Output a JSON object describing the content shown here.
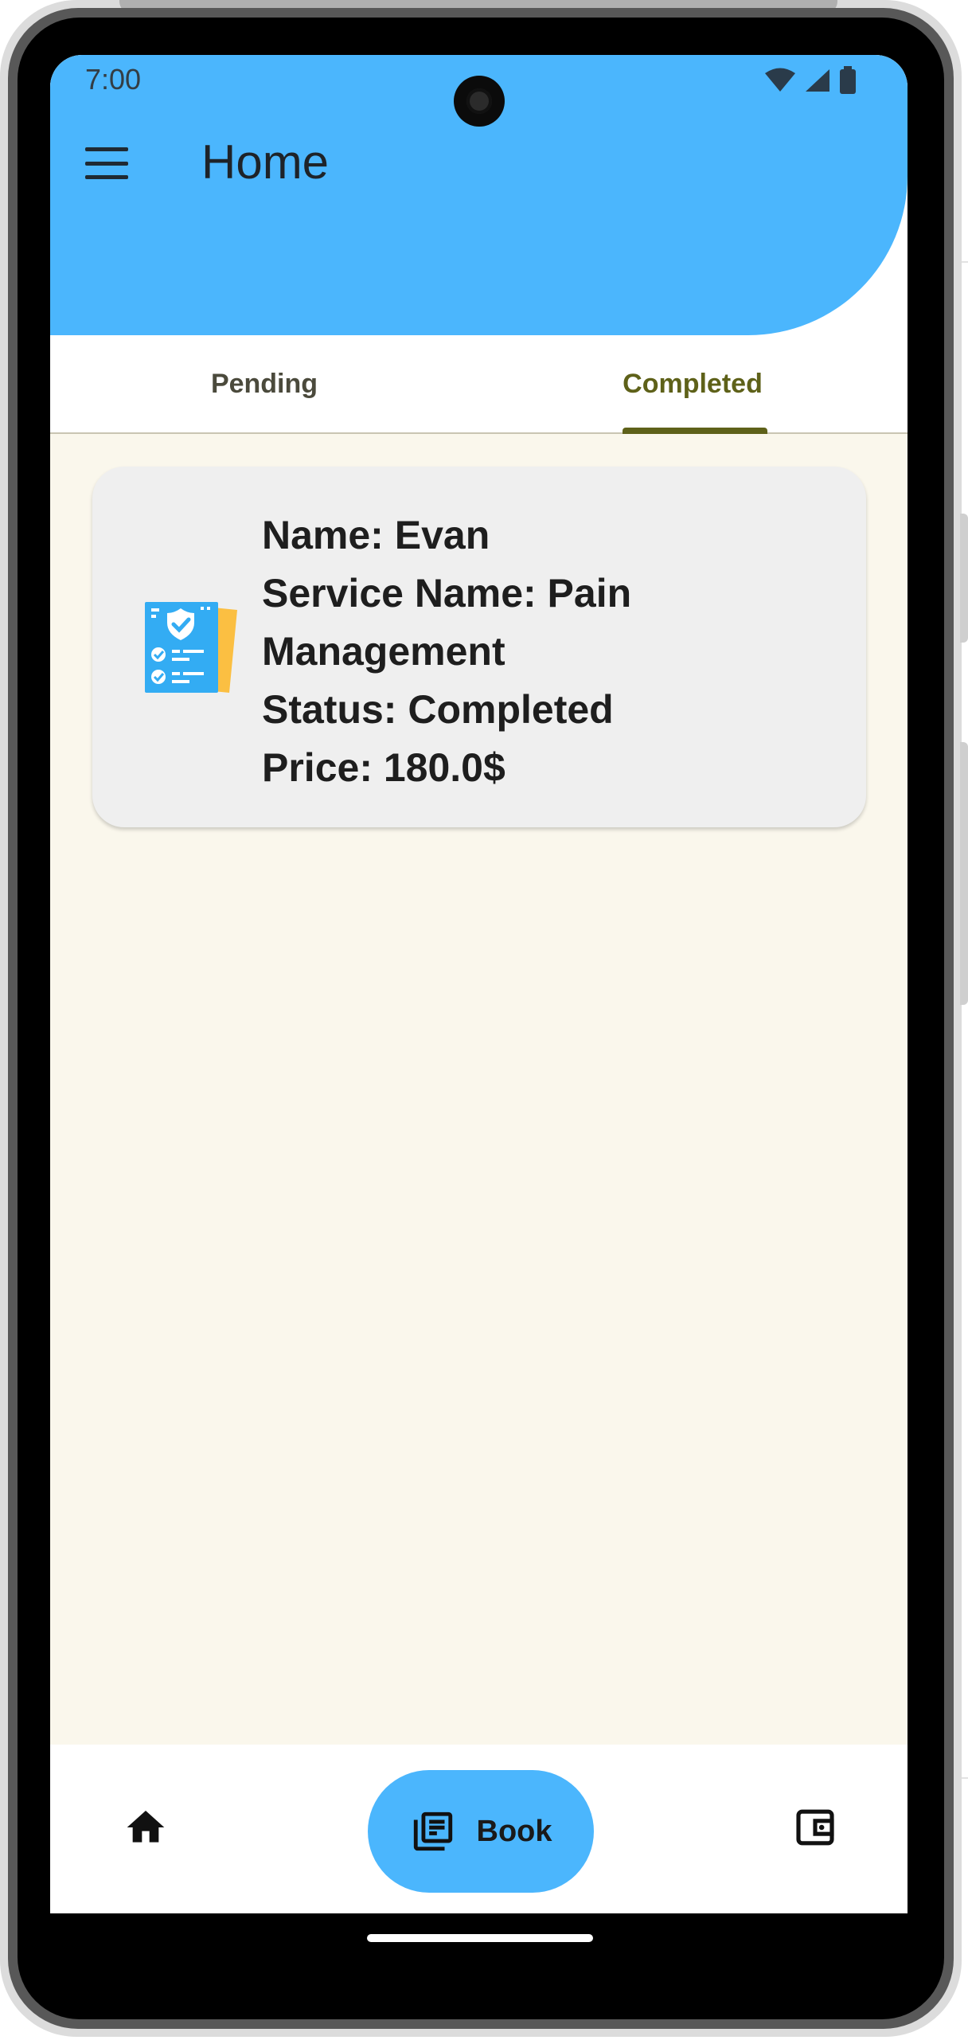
{
  "status_bar": {
    "time": "7:00",
    "icons": [
      "wifi-icon",
      "signal-icon",
      "battery-icon"
    ]
  },
  "header": {
    "menu_icon": "menu-icon",
    "title": "Home",
    "color": "#4bb6fd"
  },
  "tabs": [
    {
      "label": "Pending",
      "selected": false
    },
    {
      "label": "Completed",
      "selected": true
    }
  ],
  "accent_color": "#5e6119",
  "booking_card": {
    "icon": "document-checklist-icon",
    "name_line": "Name: Evan",
    "service_line_1": "Service Name: Pain",
    "service_line_2": "Management",
    "status_line": "Status: Completed",
    "price_line": "Price: 180.0$"
  },
  "bottom_nav": {
    "home_icon": "home-icon",
    "book_icon": "article-icon",
    "book_label": "Book",
    "wallet_icon": "wallet-icon"
  }
}
